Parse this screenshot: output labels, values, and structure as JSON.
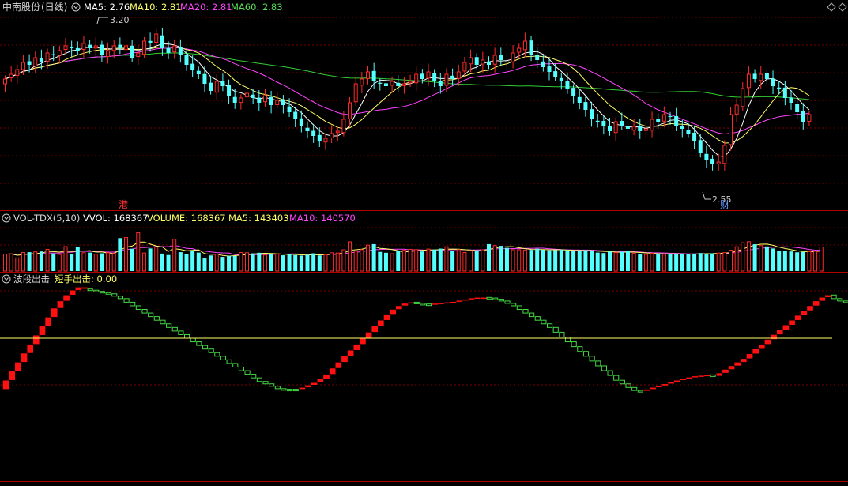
{
  "colors": {
    "background": "#000000",
    "up": "#ff2b2b",
    "down": "#54ffff",
    "ma5": "#ffff66",
    "ma10": "#ffff66",
    "ma20": "#ff44ff",
    "ma60": "#33cc33",
    "border": "#b00000",
    "grid": "#7a0000",
    "label": "#d8d8d8",
    "zero_line": "#ffff66",
    "wave_up": "#ff1111",
    "wave_down": "#44dd44"
  },
  "icons": {
    "panel_toggle": "circle-chevron-down-icon",
    "window_control": "diamond-icon"
  },
  "price_panel": {
    "stock_name": "中南股份",
    "period": "(日线)",
    "ma5_label": "MA5: 2.76",
    "ma10_label": "MA10: 2.81",
    "ma20_label": "MA20: 2.81",
    "ma60_label": "MA60: 2.83",
    "high_marker": "3.20",
    "low_marker": "2.55",
    "event_gang": "港",
    "event_cai": "财"
  },
  "volume_panel": {
    "indicator": "VOL-TDX(5,10)",
    "vvol_label": "VVOL: 168367",
    "volume_label": "VOLUME: 168367",
    "ma5_label": "MA5: 143403",
    "ma10_label": "MA10: 140570"
  },
  "wave_panel": {
    "indicator": "波段出击",
    "value_label": "短手出击: 0.00"
  },
  "chart_data": [
    {
      "type": "candlestick",
      "panel": "price",
      "ylim": [
        2.5,
        3.25
      ],
      "markers": {
        "high": 3.2,
        "low": 2.55
      },
      "ma_last": {
        "MA5": 2.76,
        "MA10": 2.81,
        "MA20": 2.81,
        "MA60": 2.83
      },
      "series": {
        "close": [
          3.0,
          3.02,
          3.04,
          3.07,
          3.06,
          3.09,
          3.07,
          3.11,
          3.1,
          3.12,
          3.14,
          3.13,
          3.12,
          3.15,
          3.13,
          3.14,
          3.1,
          3.12,
          3.14,
          3.13,
          3.14,
          3.09,
          3.11,
          3.16,
          3.15,
          3.19,
          3.13,
          3.11,
          3.14,
          3.1,
          3.06,
          3.04,
          3.02,
          2.98,
          2.95,
          2.99,
          2.97,
          2.93,
          2.9,
          2.92,
          2.94,
          2.92,
          2.9,
          2.93,
          2.89,
          2.91,
          2.89,
          2.86,
          2.83,
          2.8,
          2.78,
          2.76,
          2.74,
          2.75,
          2.77,
          2.78,
          2.83,
          2.9,
          2.98,
          3.0,
          3.03,
          2.99,
          2.98,
          2.97,
          2.99,
          2.97,
          2.98,
          2.99,
          3.02,
          3.0,
          3.03,
          2.99,
          2.97,
          3.02,
          3.0,
          3.03,
          3.07,
          3.09,
          3.06,
          3.08,
          3.06,
          3.1,
          3.08,
          3.07,
          3.11,
          3.13,
          3.16,
          3.1,
          3.08,
          3.05,
          3.03,
          3.01,
          2.99,
          2.96,
          2.93,
          2.9,
          2.87,
          2.83,
          2.82,
          2.8,
          2.78,
          2.82,
          2.8,
          2.79,
          2.8,
          2.78,
          2.79,
          2.83,
          2.82,
          2.85,
          2.84,
          2.8,
          2.79,
          2.77,
          2.74,
          2.69,
          2.66,
          2.64,
          2.65,
          2.72,
          2.85,
          2.89,
          2.96,
          3.02,
          3.0,
          3.02,
          3.0,
          2.97,
          2.96,
          2.92,
          2.9,
          2.86,
          2.82,
          2.85
        ]
      }
    },
    {
      "type": "bar",
      "panel": "volume",
      "ylim": [
        0,
        320000
      ],
      "last": {
        "VVOL": 168367,
        "VOLUME": 168367,
        "MA5": 143403,
        "MA10": 140570
      },
      "values": [
        118000,
        121000,
        92000,
        130000,
        132000,
        134000,
        137000,
        152000,
        123000,
        116000,
        171000,
        120000,
        166000,
        128000,
        129000,
        118000,
        124000,
        128000,
        123000,
        230000,
        234000,
        156000,
        268000,
        126000,
        158000,
        168000,
        122000,
        112000,
        222000,
        132000,
        118000,
        140000,
        129000,
        88000,
        109000,
        118000,
        99000,
        106000,
        105000,
        130000,
        128000,
        124000,
        128000,
        112000,
        121000,
        120000,
        110000,
        116000,
        111000,
        108000,
        113000,
        124000,
        109000,
        115000,
        128000,
        126000,
        149000,
        204000,
        139000,
        150000,
        181000,
        188000,
        134000,
        128000,
        121000,
        139000,
        145000,
        152000,
        150000,
        137000,
        154000,
        150000,
        157000,
        170000,
        140000,
        150000,
        130000,
        143000,
        145000,
        149000,
        188000,
        178000,
        176000,
        162000,
        149000,
        149000,
        147000,
        148000,
        156000,
        149000,
        145000,
        146000,
        150000,
        145000,
        138000,
        142000,
        146000,
        143000,
        129000,
        126000,
        136000,
        129000,
        135000,
        138000,
        125000,
        121000,
        116000,
        124000,
        122000,
        118000,
        120000,
        116000,
        121000,
        118000,
        121000,
        126000,
        121000,
        124000,
        126000,
        129000,
        146000,
        170000,
        198000,
        205000,
        187000,
        178000,
        172000,
        158000,
        141000,
        139000,
        137000,
        131000,
        134000,
        136000,
        138000,
        168367
      ]
    },
    {
      "type": "bar",
      "panel": "wave",
      "ylim": [
        -100,
        100
      ],
      "zero": 0,
      "last": 0.0,
      "values": [
        -85,
        -70,
        -55,
        -40,
        -25,
        -10,
        5,
        20,
        35,
        50,
        62,
        72,
        80,
        85,
        82,
        80,
        78,
        76,
        74,
        70,
        66,
        60,
        54,
        48,
        42,
        36,
        30,
        24,
        18,
        12,
        6,
        0,
        -6,
        -12,
        -18,
        -24,
        -30,
        -36,
        -42,
        -48,
        -54,
        -60,
        -66,
        -72,
        -76,
        -80,
        -84,
        -85,
        -86,
        -85,
        -82,
        -78,
        -74,
        -68,
        -60,
        -50,
        -40,
        -30,
        -20,
        -10,
        0,
        10,
        20,
        30,
        40,
        48,
        54,
        58,
        60,
        58,
        56,
        57,
        58,
        59,
        60,
        61,
        63,
        65,
        67,
        68,
        68,
        67,
        65,
        62,
        58,
        54,
        48,
        42,
        36,
        30,
        24,
        18,
        10,
        2,
        -6,
        -14,
        -22,
        -30,
        -38,
        -46,
        -54,
        -62,
        -70,
        -76,
        -82,
        -87,
        -88,
        -85,
        -82,
        -79,
        -76,
        -73,
        -70,
        -67,
        -65,
        -63,
        -62,
        -61,
        -63,
        -58,
        -52,
        -46,
        -40,
        -34,
        -26,
        -18,
        -10,
        -2,
        6,
        14,
        22,
        30,
        38,
        46,
        54,
        62,
        68,
        72,
        66,
        62,
        60
      ]
    }
  ]
}
